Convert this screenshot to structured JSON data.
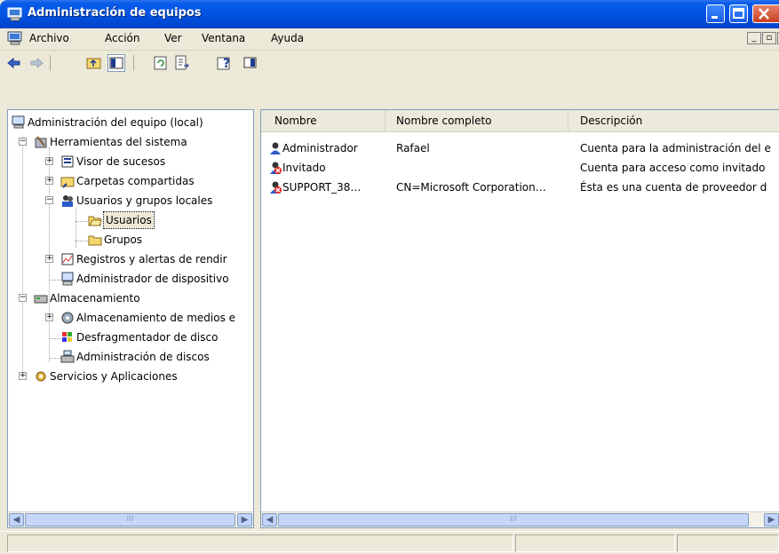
{
  "window": {
    "title": "Administración de equipos",
    "icon": "computer-management-icon"
  },
  "menubar": {
    "items": [
      {
        "label": "Archivo",
        "icon": null
      },
      {
        "label": "Acción"
      },
      {
        "label": "Ver"
      },
      {
        "label": "Ventana"
      },
      {
        "label": "Ayuda"
      }
    ]
  },
  "toolbar": {
    "buttons": [
      "back-arrow-icon",
      "forward-arrow-icon",
      "up-folder-icon",
      "show-hide-tree-icon",
      "refresh-icon",
      "export-list-icon",
      "help-icon",
      "properties-icon"
    ]
  },
  "tree": {
    "items": [
      {
        "label": "Administración del equipo (local)",
        "icon": "computer-icon"
      },
      {
        "label": "Herramientas del sistema",
        "icon": "tools-icon"
      },
      {
        "label": "Visor de sucesos",
        "icon": "event-viewer-icon"
      },
      {
        "label": "Carpetas compartidas",
        "icon": "shared-folder-icon"
      },
      {
        "label": "Usuarios y grupos locales",
        "icon": "users-groups-icon"
      },
      {
        "label": "Usuarios",
        "icon": "folder-open-icon"
      },
      {
        "label": "Grupos",
        "icon": "folder-icon"
      },
      {
        "label": "Registros y alertas de rendir",
        "icon": "performance-logs-icon"
      },
      {
        "label": "Administrador de dispositivo",
        "icon": "device-manager-icon"
      },
      {
        "label": "Almacenamiento",
        "icon": "storage-icon"
      },
      {
        "label": "Almacenamiento de medios e",
        "icon": "removable-storage-icon"
      },
      {
        "label": "Desfragmentador de disco",
        "icon": "defrag-icon"
      },
      {
        "label": "Administración de discos",
        "icon": "disk-management-icon"
      },
      {
        "label": "Servicios y Aplicaciones",
        "icon": "services-icon"
      }
    ]
  },
  "list": {
    "columns": [
      "Nombre",
      "Nombre completo",
      "Descripción"
    ],
    "rows": [
      {
        "name": "Administrador",
        "full": "Rafael",
        "desc": "Cuenta para la administración del e",
        "disabled": false
      },
      {
        "name": "Invitado",
        "full": "",
        "desc": "Cuenta para acceso como invitado",
        "disabled": true
      },
      {
        "name": "SUPPORT_38…",
        "full": "CN=Microsoft Corporation…",
        "desc": "Ésta es una cuenta de proveedor d",
        "disabled": true
      }
    ]
  },
  "scrollbar": {
    "thumb_grip": "III"
  }
}
